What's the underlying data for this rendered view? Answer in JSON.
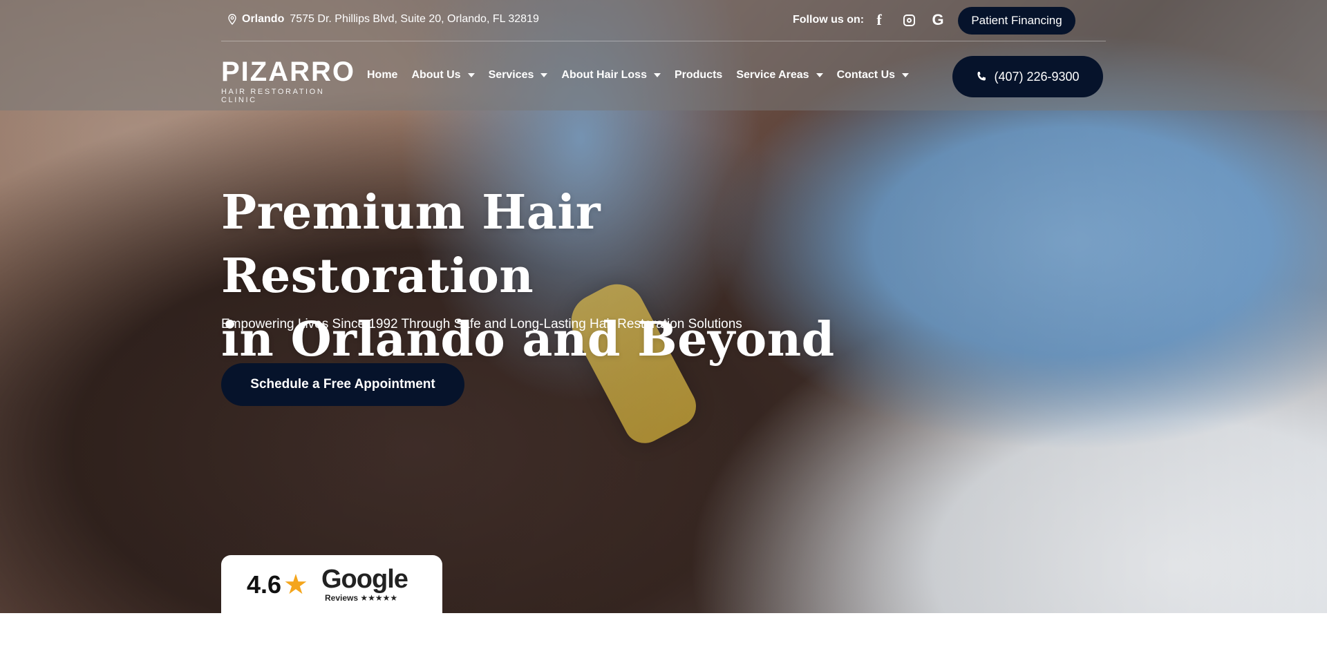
{
  "topbar": {
    "city": "Orlando",
    "address": "7575 Dr. Phillips Blvd, Suite 20, Orlando, FL 32819",
    "follow_label": "Follow us on:",
    "financing_label": "Patient Financing"
  },
  "logo": {
    "main": "PIZARRO",
    "sub": "HAIR RESTORATION CLINIC"
  },
  "nav": {
    "items": [
      {
        "label": "Home",
        "dropdown": false
      },
      {
        "label": "About Us",
        "dropdown": true
      },
      {
        "label": "Services",
        "dropdown": true
      },
      {
        "label": "About Hair Loss",
        "dropdown": true
      },
      {
        "label": "Products",
        "dropdown": false
      },
      {
        "label": "Service Areas",
        "dropdown": true
      },
      {
        "label": "Contact Us",
        "dropdown": true
      }
    ],
    "phone": "(407) 226-9300"
  },
  "hero": {
    "headline_line1": "Premium Hair Restoration",
    "headline_line2": "in Orlando and Beyond",
    "subheadline": "Empowering Lives Since 1992 Through Safe and Long-Lasting Hair Restoration Solutions",
    "cta_label": "Schedule a Free Appointment"
  },
  "reviews": {
    "rating": "4.6",
    "brand": "Google",
    "label": "Reviews ★★★★★"
  },
  "colors": {
    "primary_dark": "#06132b",
    "star": "#f4a51c"
  },
  "icons": [
    "location-pin-icon",
    "facebook-icon",
    "instagram-icon",
    "google-icon",
    "phone-icon",
    "star-icon",
    "chevron-down-icon"
  ]
}
